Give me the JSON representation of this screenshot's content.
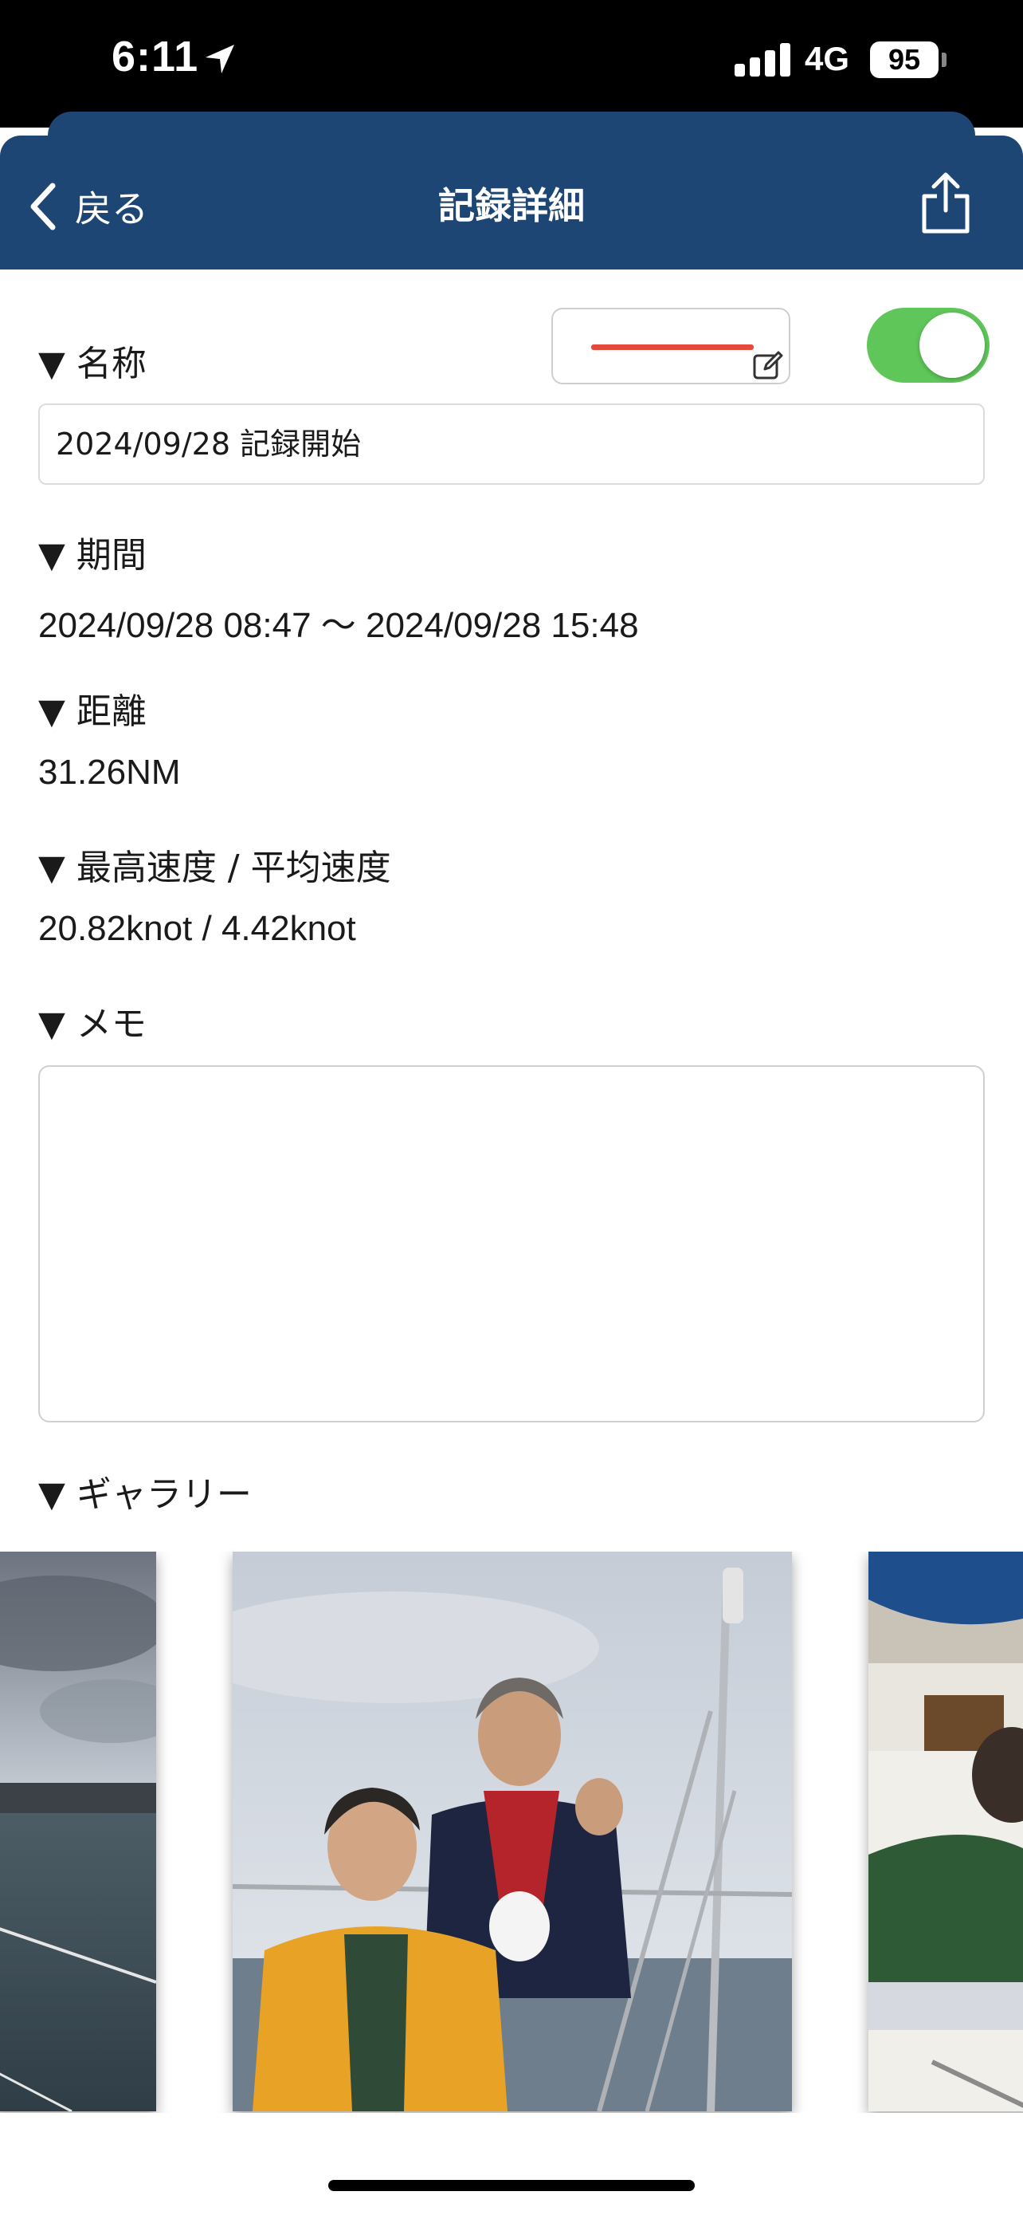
{
  "status_bar": {
    "time": "6:11",
    "network": "4G",
    "battery": "95"
  },
  "nav": {
    "back_label": "戻る",
    "title": "記録詳細"
  },
  "name_section": {
    "label": "▼ 名称",
    "value": "2024/09/28 記録開始",
    "track_color": "#e24b3b",
    "visible_toggle_on": true
  },
  "period_section": {
    "label": "▼ 期間",
    "value": "2024/09/28 08:47 〜 2024/09/28 15:48"
  },
  "distance_section": {
    "label": "▼ 距離",
    "value": "31.26NM"
  },
  "speed_section": {
    "label": "▼ 最高速度 / 平均速度",
    "value": "20.82knot / 4.42knot"
  },
  "memo_section": {
    "label": "▼ メモ",
    "value": ""
  },
  "gallery_section": {
    "label": "▼ ギャラリー"
  },
  "colors": {
    "nav_bg": "#1e4675",
    "toggle_on": "#5fc65a",
    "track_line": "#e24b3b"
  }
}
